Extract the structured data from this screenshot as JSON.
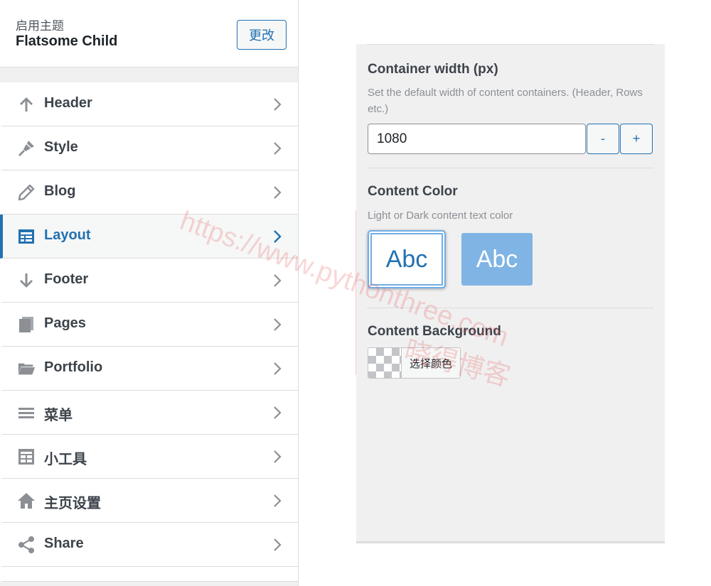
{
  "theme": {
    "caption": "启用主题",
    "name": "Flatsome Child",
    "change_label": "更改"
  },
  "menu": {
    "items": [
      {
        "label": "Header",
        "icon": "arrow-up-icon"
      },
      {
        "label": "Style",
        "icon": "paintbrush-icon"
      },
      {
        "label": "Blog",
        "icon": "pencil-icon"
      },
      {
        "label": "Layout",
        "icon": "table-layout-icon",
        "active": true
      },
      {
        "label": "Footer",
        "icon": "arrow-down-icon"
      },
      {
        "label": "Pages",
        "icon": "pages-icon"
      },
      {
        "label": "Portfolio",
        "icon": "folder-open-icon"
      },
      {
        "label": "菜单",
        "icon": "menu-lines-icon"
      },
      {
        "label": "小工具",
        "icon": "widgets-icon"
      },
      {
        "label": "主页设置",
        "icon": "home-icon"
      },
      {
        "label": "Share",
        "icon": "share-icon"
      }
    ]
  },
  "layout_settings": {
    "container_width": {
      "title": "Container width (px)",
      "description": "Set the default width of content containers. (Header, Rows etc.)",
      "value": "1080",
      "minus_label": "-",
      "plus_label": "+"
    },
    "content_color": {
      "title": "Content Color",
      "description": "Light or Dark content text color",
      "light_label": "Abc",
      "dark_label": "Abc",
      "selected": "light"
    },
    "content_background": {
      "title": "Content Background",
      "picker_label": "选择颜色"
    }
  },
  "watermark": {
    "url": "https://www.pythonthree.com",
    "text": "晓得博客"
  },
  "colors": {
    "accent": "#2271b1",
    "dark_swatch": "#7fb4e4",
    "panel_bg": "#f0f0f1"
  }
}
